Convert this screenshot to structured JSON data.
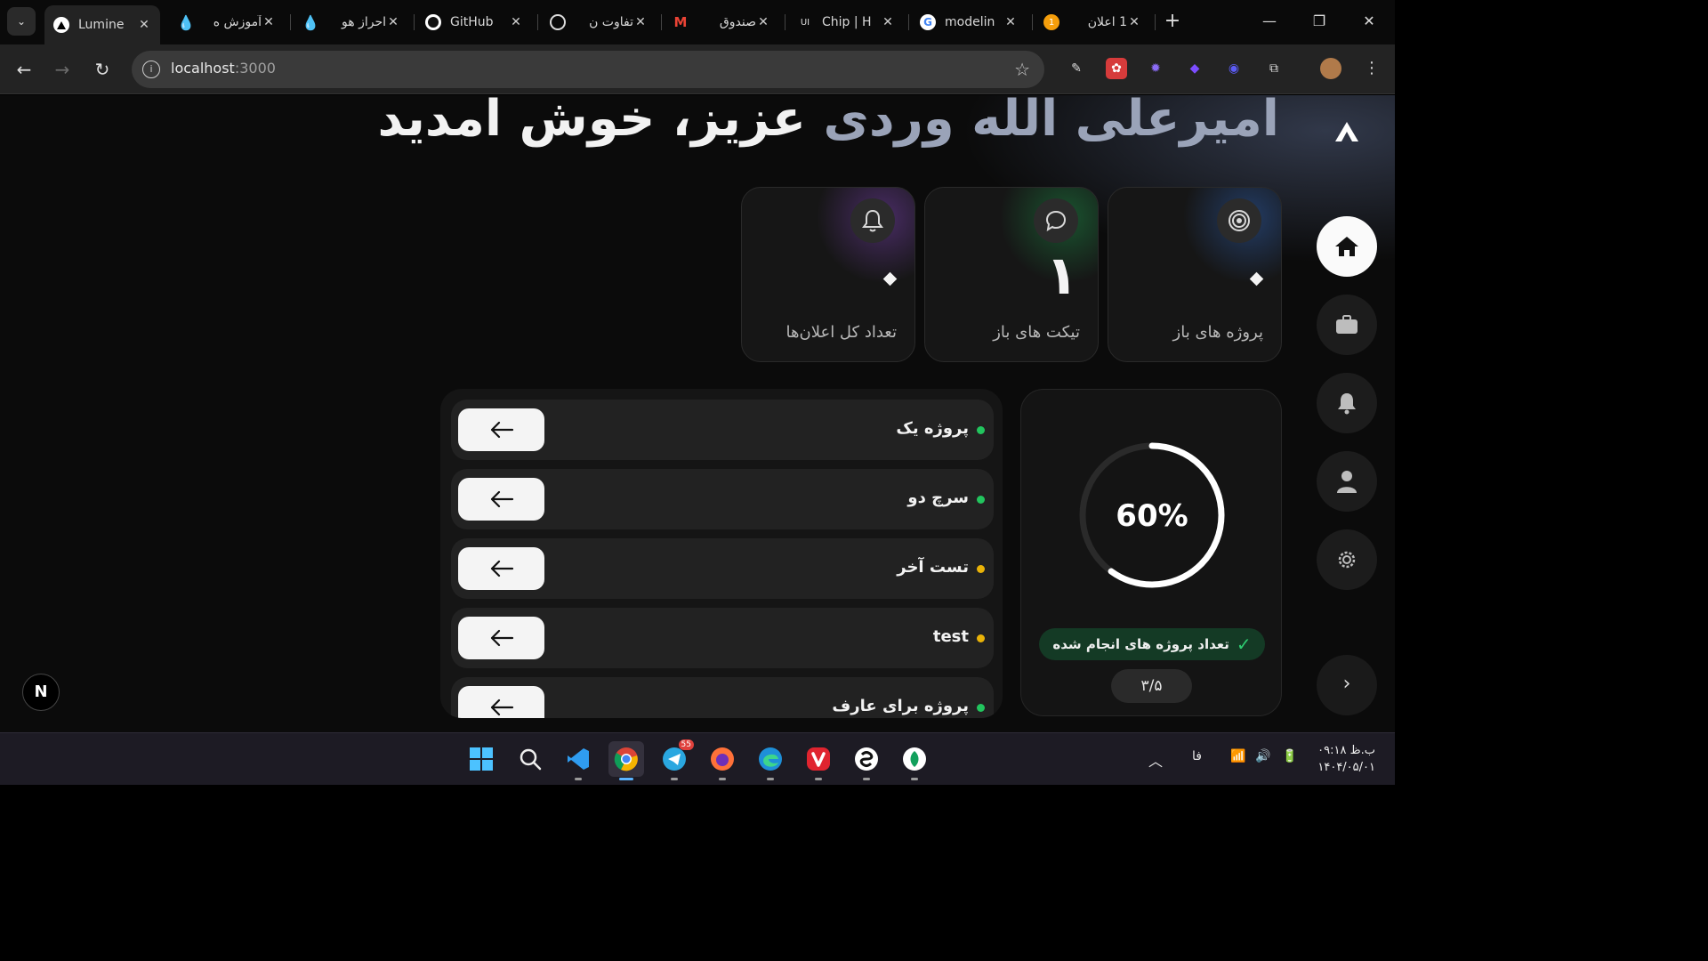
{
  "browser": {
    "tabs": [
      {
        "label": "Lumine",
        "favicon": "triangle-logo",
        "active": true
      },
      {
        "label": "آموزش ه",
        "favicon": "drop-icon"
      },
      {
        "label": "احراز هو",
        "favicon": "drop-icon"
      },
      {
        "label": "GitHub",
        "favicon": "github-icon"
      },
      {
        "label": "تفاوت ن",
        "favicon": "openai-icon"
      },
      {
        "label": "صندوق",
        "favicon": "gmail-icon"
      },
      {
        "label": "Chip | H",
        "favicon": "ui-icon",
        "favicon_text": "UI"
      },
      {
        "label": "modelin",
        "favicon": "google-icon"
      },
      {
        "label": "1 اعلان",
        "favicon": "badge-icon",
        "favicon_text": "1"
      }
    ],
    "url_host": "localhost",
    "url_port": ":3000"
  },
  "page": {
    "welcome_name": "امیرعلی الله وردی",
    "welcome_rest": " عزیز، خوش آمدید",
    "stats": [
      {
        "label": "تعداد کل اعلان‌ها",
        "value": "",
        "icon": "bell-icon",
        "accent": "#a855f7"
      },
      {
        "label": "تیکت های باز",
        "value": "۱",
        "icon": "chat-icon",
        "accent": "#22c55e"
      },
      {
        "label": "پروژه های باز",
        "value": "",
        "icon": "target-icon",
        "accent": "#3b82f6"
      }
    ],
    "projects": [
      {
        "name": "پروژه یک",
        "status_color": "#22c55e"
      },
      {
        "name": "سرچ دو",
        "status_color": "#22c55e"
      },
      {
        "name": "تست آخر",
        "status_color": "#eab308"
      },
      {
        "name": "test",
        "status_color": "#eab308"
      },
      {
        "name": "پروژه برای عارف",
        "status_color": "#22c55e"
      }
    ],
    "progress": {
      "percent": 60,
      "percent_label": "60%",
      "done_label": "تعداد پروژه های انجام شده",
      "ratio": "۳/۵"
    },
    "nextjs_badge": "N"
  },
  "taskbar": {
    "telegram_badge": "55",
    "lang": "فا",
    "time": "۰۹:۱۸ ب.ظ",
    "date": "۱۴۰۴/۰۵/۰۱"
  }
}
